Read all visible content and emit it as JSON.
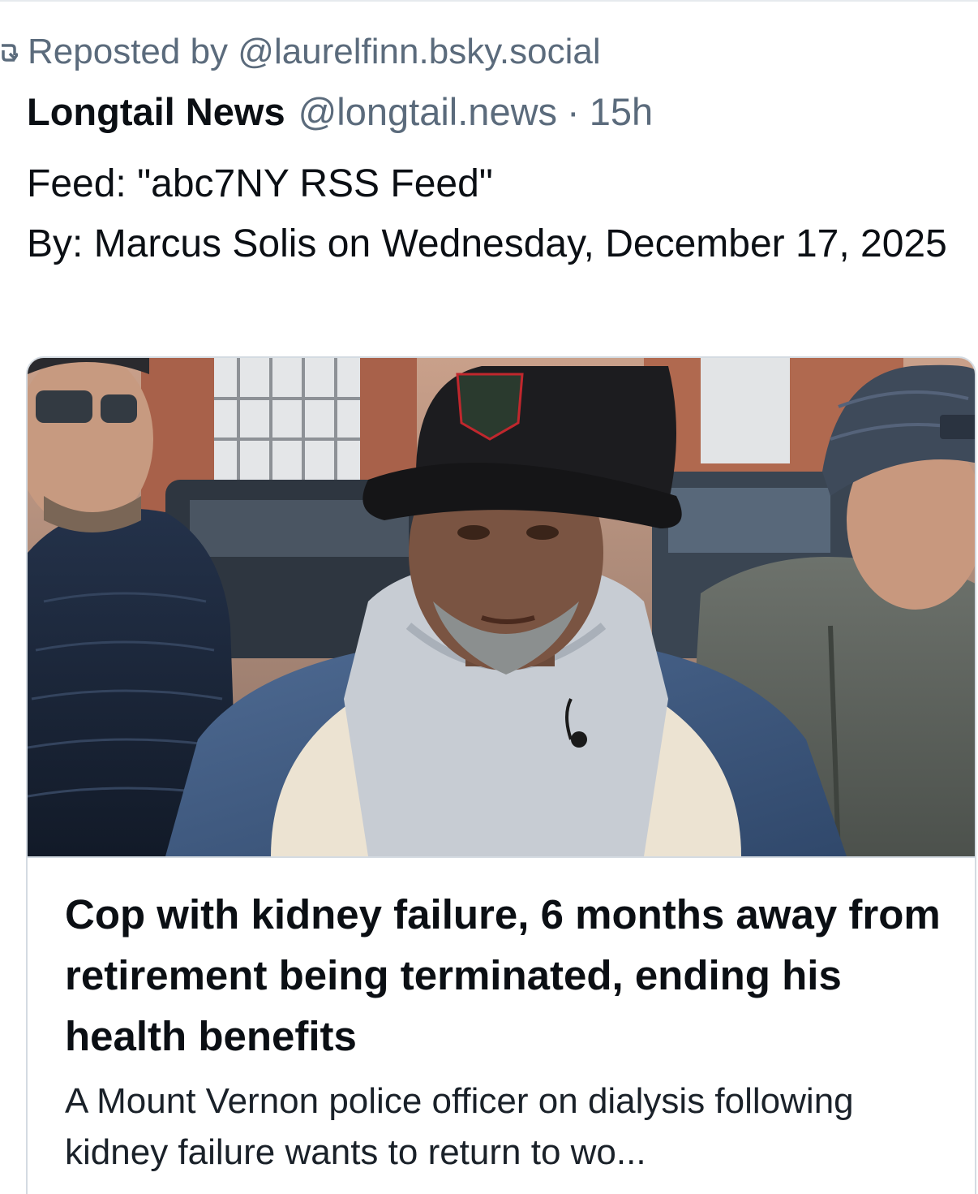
{
  "repost": {
    "icon": "repost-icon",
    "text": "Reposted by @laurelfinn.bsky.social"
  },
  "post": {
    "author_name": "Longtail News",
    "author_handle": "@longtail.news",
    "separator": "·",
    "time": "15h",
    "feed_line": "Feed: \"abc7NY RSS Feed\"",
    "byline": "By: Marcus Solis on Wednesday, December 17, 2025"
  },
  "link_card": {
    "image_label": "news-photo",
    "title": "Cop with kidney failure, 6 months away from retirement being terminated, ending his health benefits",
    "description": "A Mount Vernon police officer on dialysis following kidney failure wants to return to wo..."
  },
  "colors": {
    "muted_text": "#5b6b7c",
    "primary_text": "#0b0f14",
    "card_border": "#d4dbe2"
  }
}
